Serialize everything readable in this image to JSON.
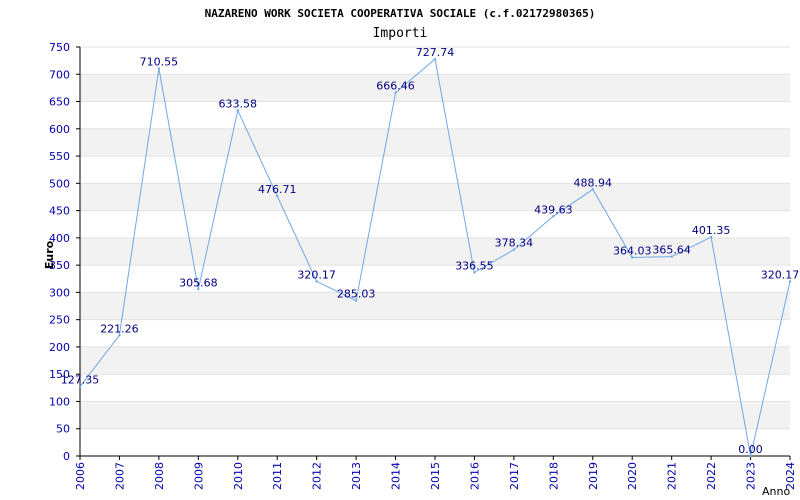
{
  "chart_data": {
    "type": "line",
    "title": "NAZARENO WORK SOCIETA COOPERATIVA SOCIALE (c.f.02172980365)",
    "subtitle": "Importi",
    "xlabel": "Anno",
    "ylabel": "Euro",
    "x": [
      "2006",
      "2007",
      "2008",
      "2009",
      "2010",
      "2011",
      "2012",
      "2013",
      "2014",
      "2015",
      "2016",
      "2017",
      "2018",
      "2019",
      "2020",
      "2021",
      "2022",
      "2023",
      "2024"
    ],
    "series": [
      {
        "values": [
          127.35,
          221.26,
          710.55,
          305.68,
          633.58,
          476.71,
          320.17,
          285.03,
          666.46,
          727.74,
          336.55,
          378.34,
          439.63,
          488.94,
          364.03,
          365.64,
          401.35,
          0.0,
          320.17
        ],
        "labels": [
          "127.35",
          "221.26",
          "710.55",
          "305.68",
          "633.58",
          "476.71",
          "320.17",
          "285.03",
          "666.46",
          "727.74",
          "336.55",
          "378.34",
          "439.63",
          "488.94",
          "364.03",
          "365.64",
          "401.35",
          "0.00",
          "320.17"
        ]
      }
    ],
    "yticks": [
      "0",
      "50",
      "100",
      "150",
      "200",
      "250",
      "300",
      "350",
      "400",
      "450",
      "500",
      "550",
      "600",
      "650",
      "700",
      "750"
    ],
    "ylim": [
      0,
      750
    ],
    "grid": true,
    "colors": {
      "line": "#6fa8e8",
      "label": "#000080",
      "tick": "#0000b0",
      "band": "#f2f2f2",
      "axis": "#000000"
    }
  }
}
